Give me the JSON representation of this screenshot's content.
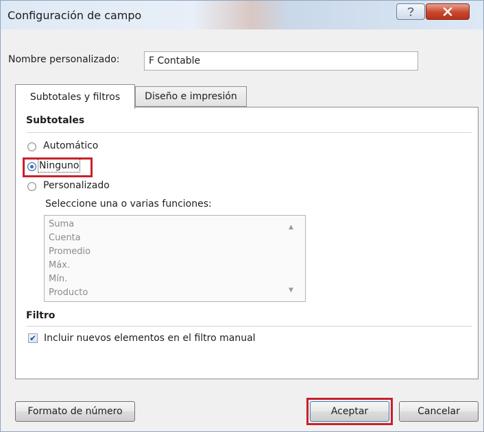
{
  "window": {
    "title": "Configuración de campo"
  },
  "name_field": {
    "label": "Nombre personalizado:",
    "value": "F Contable"
  },
  "tabs": [
    {
      "label": "Subtotales y filtros",
      "active": true
    },
    {
      "label": "Diseño e impresión",
      "active": false
    }
  ],
  "subtotals": {
    "heading": "Subtotales",
    "options": [
      {
        "label": "Automático",
        "checked": false
      },
      {
        "label": "Ninguno",
        "checked": true
      },
      {
        "label": "Personalizado",
        "checked": false
      }
    ],
    "functions_label": "Seleccione una o varias funciones:",
    "functions": [
      "Suma",
      "Cuenta",
      "Promedio",
      "Máx.",
      "Mín.",
      "Producto"
    ]
  },
  "filter": {
    "heading": "Filtro",
    "include_label": "Incluir nuevos elementos en el filtro manual",
    "include_checked": true
  },
  "buttons": {
    "format": "Formato de número",
    "accept": "Aceptar",
    "cancel": "Cancelar"
  },
  "colors": {
    "highlight": "#c8202a",
    "close_button": "#c9462d"
  },
  "icons": {
    "help": "question-mark",
    "close": "x-mark",
    "scroll_up": "triangle-up",
    "scroll_down": "triangle-down",
    "checkmark": "check"
  }
}
